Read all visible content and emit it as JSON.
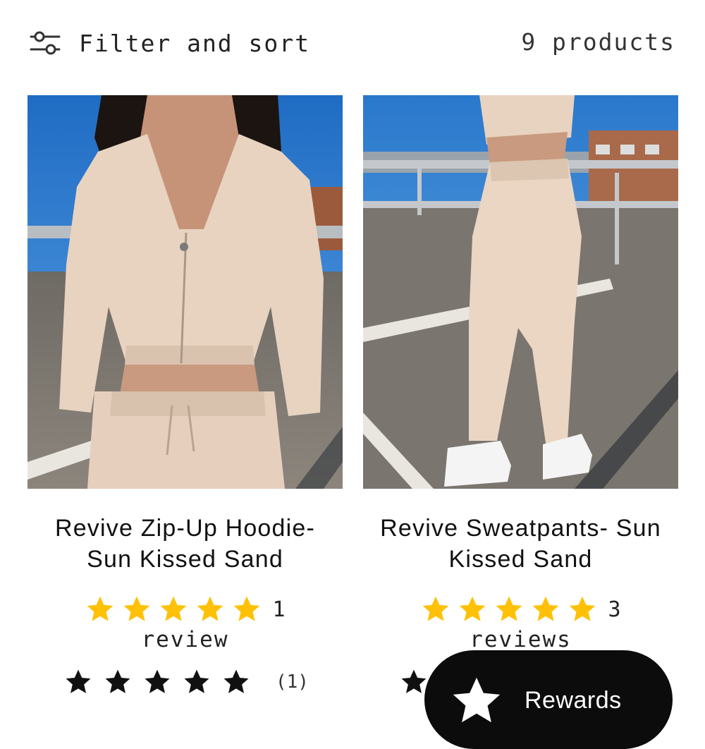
{
  "toolbar": {
    "filter_label": "Filter and sort",
    "product_count": "9 products"
  },
  "products": [
    {
      "title": "Revive Zip-Up Hoodie- Sun Kissed Sand",
      "rating": 5,
      "rating_count": "1",
      "review_word": "review",
      "judge_rating": 5,
      "judge_count": "(1)"
    },
    {
      "title": "Revive Sweatpants- Sun Kissed Sand",
      "rating": 5,
      "rating_count": "3",
      "review_word": "reviews",
      "judge_rating": 5,
      "judge_count": ""
    }
  ],
  "rewards": {
    "label": "Rewards"
  },
  "colors": {
    "star_gold": "#FFC107",
    "star_black": "#111111",
    "fabric": "#E8D3C0",
    "sky": "#2F7FD0",
    "ground": "#7A756E"
  },
  "icons": {
    "filter": "sliders-icon",
    "rating_star": "star-icon",
    "rewards": "star-icon"
  }
}
